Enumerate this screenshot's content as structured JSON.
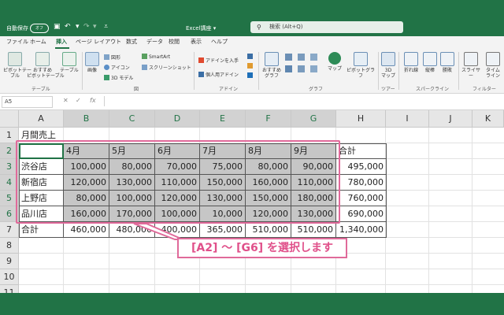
{
  "titlebar": {
    "autosave_label": "自動保存",
    "autosave_state": "オフ",
    "filename": "Excel講座",
    "filename_arrow": "▾",
    "search_placeholder": "検索 (Alt+Q)"
  },
  "tabs": [
    "ファイル",
    "ホーム",
    "挿入",
    "ページ レイアウト",
    "数式",
    "データ",
    "校閲",
    "表示",
    "ヘルプ"
  ],
  "ribbon": {
    "pivot_table": "ピボットテー\nブル",
    "recommended_pivot": "おすすめ\nピボットテーブル",
    "table": "テーブル",
    "group_table": "テーブル",
    "image": "画像",
    "shape": "図形",
    "icon": "アイコン",
    "model3d": "3D モデル",
    "smartart": "SmartArt",
    "screenshot": "スクリーンショット",
    "group_figure": "図",
    "get_addin": "アドインを入手",
    "personal_addin": "個人用アドイン",
    "group_addin": "アドイン",
    "recommended_chart": "おすすめ\nグラフ",
    "group_chart": "グラフ",
    "map": "マップ",
    "pivot_chart": "ピボットグラフ",
    "map3d": "3D\nマップ",
    "group_tour": "ツアー",
    "line": "折れ線",
    "column": "縦棒",
    "winloss": "勝敗",
    "group_sparkline": "スパークライン",
    "slicer": "スライサー",
    "timeline": "タイム\nライン",
    "group_filter": "フィルター"
  },
  "formula_bar": {
    "name_box": "A5",
    "fx": "fx"
  },
  "columns": [
    "A",
    "B",
    "C",
    "D",
    "E",
    "F",
    "G",
    "H",
    "I",
    "J",
    "K"
  ],
  "rows": [
    "1",
    "2",
    "3",
    "4",
    "5",
    "6",
    "7",
    "8",
    "9",
    "10",
    "11"
  ],
  "sheet": {
    "title": "月間売上",
    "headers": [
      "4月",
      "5月",
      "6月",
      "7月",
      "8月",
      "9月",
      "合計"
    ],
    "data": [
      {
        "store": "渋谷店",
        "values": [
          "100,000",
          "80,000",
          "70,000",
          "75,000",
          "80,000",
          "90,000"
        ],
        "total": "495,000"
      },
      {
        "store": "新宿店",
        "values": [
          "120,000",
          "130,000",
          "110,000",
          "150,000",
          "160,000",
          "110,000"
        ],
        "total": "780,000"
      },
      {
        "store": "上野店",
        "values": [
          "80,000",
          "100,000",
          "120,000",
          "130,000",
          "150,000",
          "180,000"
        ],
        "total": "760,000"
      },
      {
        "store": "品川店",
        "values": [
          "160,000",
          "170,000",
          "100,000",
          "10,000",
          "120,000",
          "130,000"
        ],
        "total": "690,000"
      }
    ],
    "total_row": {
      "label": "合計",
      "values": [
        "460,000",
        "480,000",
        "400,000",
        "365,000",
        "510,000",
        "510,000"
      ],
      "total": "1,340,000"
    }
  },
  "annotation": {
    "text": "[A2] ～ [G6] を選択します",
    "color": "#e06a9a"
  },
  "colors": {
    "excel_green": "#217346",
    "selection_gray": "#c6c6c6"
  }
}
